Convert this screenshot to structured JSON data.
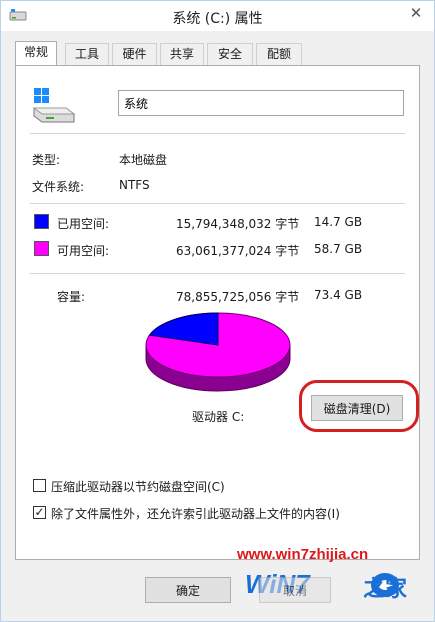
{
  "window": {
    "title": "系统 (C:) 属性",
    "close_glyph": "✕"
  },
  "tabs": [
    {
      "label": "常规",
      "active": true
    },
    {
      "label": "工具"
    },
    {
      "label": "硬件"
    },
    {
      "label": "共享"
    },
    {
      "label": "安全"
    },
    {
      "label": "配额"
    }
  ],
  "general": {
    "name_value": "系统",
    "type_label": "类型:",
    "type_value": "本地磁盘",
    "fs_label": "文件系统:",
    "fs_value": "NTFS",
    "used": {
      "label": "已用空间:",
      "bytes": "15,794,348,032 字节",
      "size": "14.7 GB",
      "color": "#0000ff"
    },
    "free": {
      "label": "可用空间:",
      "bytes": "63,061,377,024 字节",
      "size": "58.7 GB",
      "color": "#ff00ff"
    },
    "capacity": {
      "label": "容量:",
      "bytes": "78,855,725,056 字节",
      "size": "73.4 GB"
    },
    "chart_used_fraction": 0.2003,
    "drive_label": "驱动器 C:",
    "cleanup_button": "磁盘清理(D)",
    "compress_checkbox": {
      "label": "压缩此驱动器以节约磁盘空间(C)",
      "checked": false
    },
    "index_checkbox": {
      "label": "除了文件属性外，还允许索引此驱动器上文件的内容(I)",
      "checked": true,
      "check_glyph": "✓"
    }
  },
  "footer": {
    "ok_button": "确定",
    "cancel_button": "取消"
  },
  "watermark": {
    "url": "www.win7zhijia.cn",
    "logo_text": "WiN7",
    "logo_suffix": "之家"
  },
  "colors": {
    "highlight_circle": "#d42020",
    "watermark": "#e0161a"
  }
}
